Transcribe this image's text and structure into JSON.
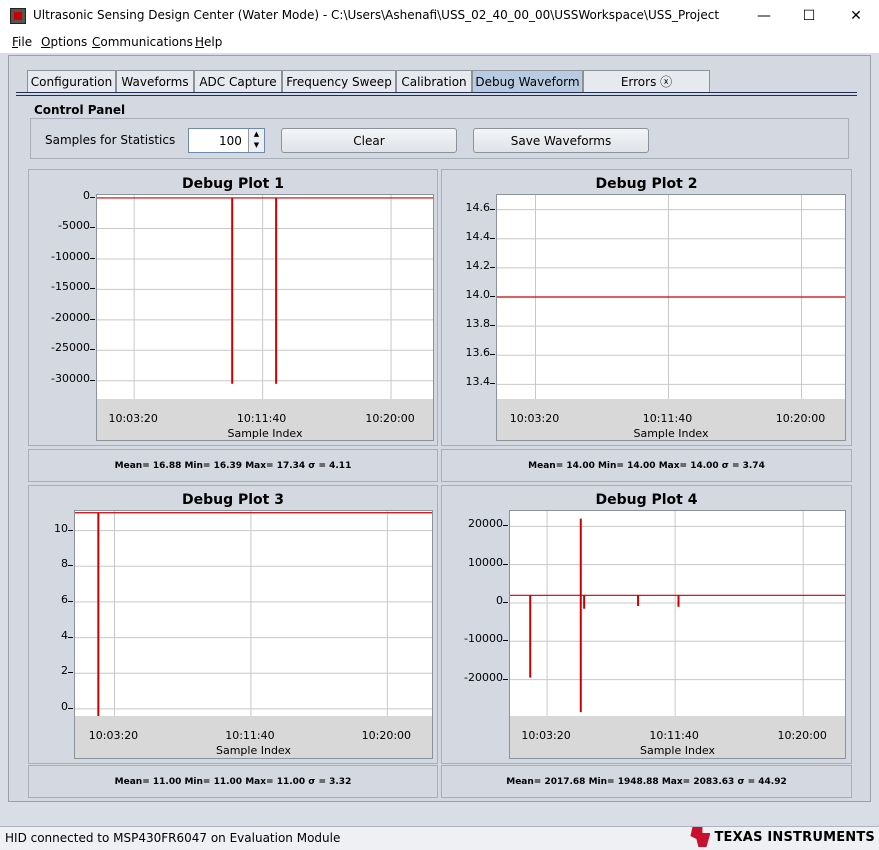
{
  "window": {
    "title": "Ultrasonic Sensing Design Center (Water Mode) - C:\\Users\\Ashenafi\\USS_02_40_00_00\\USSWorkspace\\USS_Project",
    "minimize": "—",
    "maximize": "☐",
    "close": "✕"
  },
  "menu": {
    "file": {
      "mnemonic": "F",
      "rest": "ile"
    },
    "options": {
      "mnemonic": "O",
      "rest": "ptions"
    },
    "communications": {
      "mnemonic": "C",
      "rest": "ommunications"
    },
    "help": {
      "mnemonic": "H",
      "rest": "elp"
    }
  },
  "tabs": [
    "Configuration",
    "Waveforms",
    "ADC Capture",
    "Frequency Sweep",
    "Calibration",
    "Debug Waveform",
    "Errors"
  ],
  "errors_tab_icon": "ⓧ",
  "control_panel": {
    "title": "Control Panel",
    "samples_label": "Samples for Statistics",
    "samples_value": "100",
    "clear_label": "Clear",
    "save_label": "Save Waveforms"
  },
  "plots": [
    {
      "title": "Debug Plot 1",
      "xlabel": "Sample Index",
      "stats": "Mean= 16.88 Min= 16.39 Max= 17.34 σ = 4.11"
    },
    {
      "title": "Debug Plot 2",
      "xlabel": "Sample Index",
      "stats": "Mean= 14.00 Min= 14.00 Max= 14.00 σ = 3.74"
    },
    {
      "title": "Debug Plot 3",
      "xlabel": "Sample Index",
      "stats": "Mean= 11.00 Min= 11.00 Max= 11.00 σ = 3.32"
    },
    {
      "title": "Debug Plot 4",
      "xlabel": "Sample Index",
      "stats": "Mean= 2017.68 Min= 1948.88 Max= 2083.63 σ = 44.92"
    }
  ],
  "chart_data": [
    {
      "type": "line",
      "title": "Debug Plot 1",
      "xlabel": "Sample Index",
      "xticks": [
        "10:03:20",
        "10:11:40",
        "10:20:00"
      ],
      "yticks": [
        "0",
        "-5000",
        "-10000",
        "-15000",
        "-20000",
        "-25000",
        "-30000"
      ],
      "ytick_values": [
        0,
        -5000,
        -10000,
        -15000,
        -20000,
        -25000,
        -30000
      ],
      "ylim": [
        -33000,
        500
      ],
      "baseline": 17,
      "spikes": [
        {
          "x": 0.4,
          "y": -30500
        },
        {
          "x": 0.53,
          "y": -30500
        }
      ],
      "color": "#cc0000"
    },
    {
      "type": "line",
      "title": "Debug Plot 2",
      "xlabel": "Sample Index",
      "xticks": [
        "10:03:20",
        "10:11:40",
        "10:20:00"
      ],
      "yticks": [
        "14.6",
        "14.4",
        "14.2",
        "14.0",
        "13.8",
        "13.6",
        "13.4"
      ],
      "ytick_values": [
        14.6,
        14.4,
        14.2,
        14.0,
        13.8,
        13.6,
        13.4
      ],
      "ylim": [
        13.3,
        14.7
      ],
      "baseline": 14.0,
      "spikes": [],
      "color": "#cc0000"
    },
    {
      "type": "line",
      "title": "Debug Plot 3",
      "xlabel": "Sample Index",
      "xticks": [
        "10:03:20",
        "10:11:40",
        "10:20:00"
      ],
      "yticks": [
        "10",
        "8",
        "6",
        "4",
        "2",
        "0"
      ],
      "ytick_values": [
        10,
        8,
        6,
        4,
        2,
        0
      ],
      "ylim": [
        -0.4,
        11.1
      ],
      "baseline": 11,
      "spikes": [
        {
          "x": 0.065,
          "y": -0.4
        }
      ],
      "color": "#cc0000"
    },
    {
      "type": "line",
      "title": "Debug Plot 4",
      "xlabel": "Sample Index",
      "xticks": [
        "10:03:20",
        "10:11:40",
        "10:20:00"
      ],
      "yticks": [
        "20000",
        "10000",
        "0",
        "-10000",
        "-20000"
      ],
      "ytick_values": [
        20000,
        10000,
        0,
        -10000,
        -20000
      ],
      "ylim": [
        -29500,
        24000
      ],
      "baseline": 2000,
      "spikes": [
        {
          "x": 0.06,
          "y": -19500
        },
        {
          "x": 0.21,
          "y": 22000
        },
        {
          "x": 0.21,
          "y": -28500
        },
        {
          "x": 0.22,
          "y": -1500
        },
        {
          "x": 0.38,
          "y": -800
        },
        {
          "x": 0.5,
          "y": -1000
        }
      ],
      "color": "#cc0000"
    }
  ],
  "status": {
    "text": "HID connected to MSP430FR6047 on Evaluation Module"
  },
  "logo": {
    "text": "TEXAS INSTRUMENTS"
  }
}
